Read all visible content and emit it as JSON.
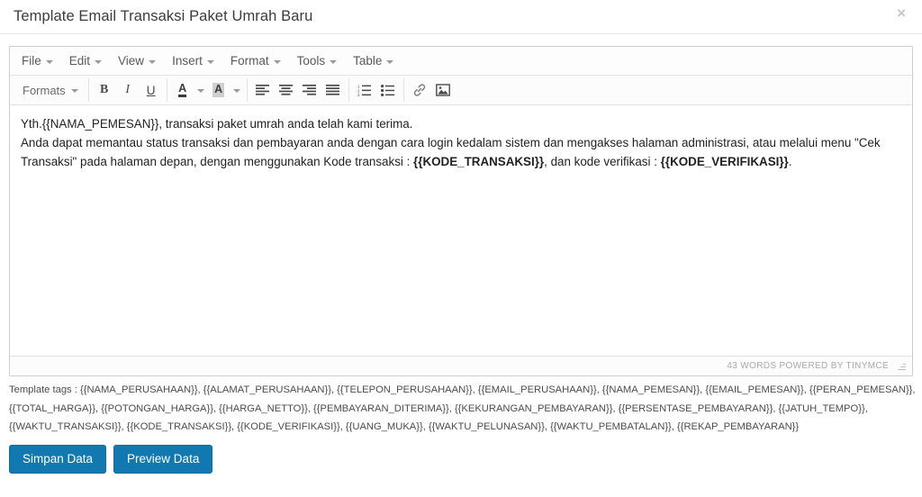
{
  "modal": {
    "title": "Template Email Transaksi Paket Umrah Baru",
    "close_label": "×",
    "close_icon": "close-icon"
  },
  "editor": {
    "menubar": [
      {
        "label": "File",
        "icon": "chevron-down-icon"
      },
      {
        "label": "Edit",
        "icon": "chevron-down-icon"
      },
      {
        "label": "View",
        "icon": "chevron-down-icon"
      },
      {
        "label": "Insert",
        "icon": "chevron-down-icon"
      },
      {
        "label": "Format",
        "icon": "chevron-down-icon"
      },
      {
        "label": "Tools",
        "icon": "chevron-down-icon"
      },
      {
        "label": "Table",
        "icon": "chevron-down-icon"
      }
    ],
    "toolbar": {
      "formats_label": "Formats",
      "bold_label": "B",
      "italic_label": "I",
      "underline_label": "U",
      "forecolor_label": "A",
      "backcolor_label": "A",
      "icons": {
        "formats_caret": "chevron-down-icon",
        "bold": "bold-icon",
        "italic": "italic-icon",
        "underline": "underline-icon",
        "forecolor": "text-color-icon",
        "forecolor_caret": "chevron-down-icon",
        "backcolor": "background-color-icon",
        "backcolor_caret": "chevron-down-icon",
        "align_left": "align-left-icon",
        "align_center": "align-center-icon",
        "align_right": "align-right-icon",
        "align_justify": "align-justify-icon",
        "numbered_list": "numbered-list-icon",
        "bulleted_list": "bulleted-list-icon",
        "link": "link-icon",
        "image": "image-icon"
      }
    },
    "content": {
      "line1_plain": "Yth.{{NAMA_PEMESAN}}, transaksi paket umrah anda telah kami terima.",
      "line2_part1": "Anda dapat memantau status transaksi dan pembayaran anda dengan cara login kedalam sistem dan mengakses halaman administrasi, atau melalui menu \"Cek Transaksi\" pada halaman depan, dengan menggunakan Kode transaksi : ",
      "line2_bold1": "{{KODE_TRANSAKSI}}",
      "line2_part2": ", dan kode verifikasi : ",
      "line2_bold2": "{{KODE_VERIFIKASI}}",
      "line2_part3": "."
    },
    "statusbar": {
      "word_count": "43 WORDS POWERED BY TINYMCE",
      "resize_icon": "resize-grip-icon"
    }
  },
  "template_tags": {
    "line1": "Template tags : {{NAMA_PERUSAHAAN}}, {{ALAMAT_PERUSAHAAN}}, {{TELEPON_PERUSAHAAN}}, {{EMAIL_PERUSAHAAN}}, {{NAMA_PEMESAN}}, {{EMAIL_PEMESAN}}, {{PERAN_PEMESAN}},",
    "line2": "{{TOTAL_HARGA}}, {{POTONGAN_HARGA}}, {{HARGA_NETTO}}, {{PEMBAYARAN_DITERIMA}}, {{KEKURANGAN_PEMBAYARAN}}, {{PERSENTASE_PEMBAYARAN}}, {{JATUH_TEMPO}},",
    "line3": "{{WAKTU_TRANSAKSI}}, {{KODE_TRANSAKSI}}, {{KODE_VERIFIKASI}}, {{UANG_MUKA}}, {{WAKTU_PELUNASAN}}, {{WAKTU_PEMBATALAN}}, {{REKAP_PEMBAYARAN}}"
  },
  "footer": {
    "save_label": "Simpan Data",
    "preview_label": "Preview Data"
  },
  "colors": {
    "primary_button": "#1179b0",
    "title_text": "#3b3b3b",
    "body_text": "#222222"
  }
}
